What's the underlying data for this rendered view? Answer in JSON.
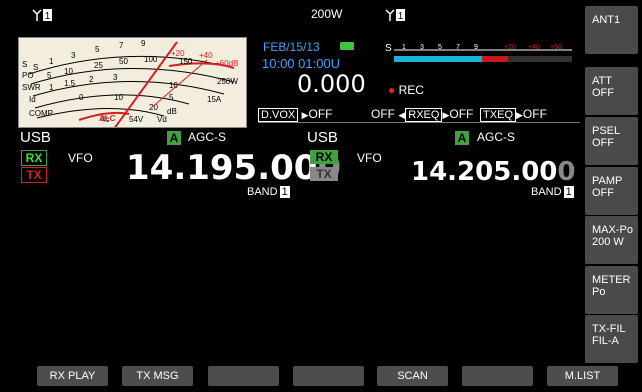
{
  "left": {
    "power_value": "200W",
    "date": "FEB/15/13",
    "time": "10:00 01:00U",
    "offset": "0.000",
    "mode": "USB",
    "agc_letter": "A",
    "agc": "AGC-S",
    "rx": "RX",
    "tx": "TX",
    "vfo": "VFO",
    "freq_main": "14.195.00",
    "freq_last": "0",
    "band": "BAND",
    "band_num": "1",
    "dvox_label": "D.VOX",
    "dvox_state": "OFF",
    "meter_scales": [
      "S",
      "PO",
      "SWR",
      "Id",
      "COMP",
      "ALC"
    ]
  },
  "right": {
    "s_label": "S",
    "rec": "REC",
    "off_label": "OFF",
    "rxeq_label": "RXEQ",
    "rxeq_state": "OFF",
    "txeq_label": "TXEQ",
    "txeq_state": "OFF",
    "mode": "USB",
    "agc_letter": "A",
    "agc": "AGC-S",
    "rx": "RX",
    "tx": "TX",
    "vfo": "VFO",
    "freq_main": "14.205.00",
    "freq_last": "0",
    "band": "BAND",
    "band_num": "1"
  },
  "side_buttons": [
    "ANT1",
    "ATT\nOFF",
    "PSEL\nOFF",
    "PAMP\nOFF",
    "MAX-Po\n200 W",
    "METER\nPo",
    "TX-FIL\nFIL-A"
  ],
  "bottom_buttons": [
    "RX PLAY",
    "TX MSG",
    "",
    "",
    "SCAN",
    "",
    "M.LIST"
  ],
  "colors": {
    "green": "#3fa13f",
    "red": "#d42020",
    "cyan": "#1fb0d8",
    "blue_text": "#3fa0ff"
  }
}
